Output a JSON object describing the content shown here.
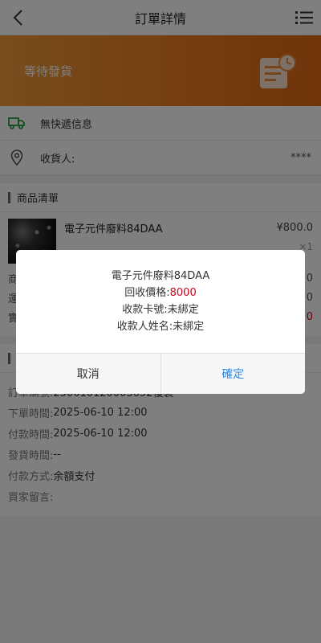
{
  "header": {
    "title": "訂單詳情",
    "back_icon": "back-arrow-icon",
    "menu_icon": "list-menu-icon"
  },
  "banner": {
    "status": "等待發貨",
    "icon": "order-clock-icon",
    "colors": [
      "#f09a3b",
      "#e06916"
    ]
  },
  "shipping": {
    "label": "無快遞信息",
    "icon": "truck-icon"
  },
  "receiver": {
    "label": "收貨人:",
    "value": "****",
    "icon": "location-pin-icon"
  },
  "product_section": {
    "title": "商品清單",
    "product": {
      "name": "電子元件廢料84DAA",
      "price": "¥800.0",
      "qty": "×1"
    },
    "summary": [
      {
        "label": "商",
        "value": "0"
      },
      {
        "label": "運",
        "value": "0"
      },
      {
        "label": "實",
        "value": "0"
      }
    ]
  },
  "order_section": {
    "title": "",
    "rows": [
      {
        "key": "訂單編號:",
        "value": "250610120003652複製"
      },
      {
        "key": "下單時間:",
        "value": "2025-06-10 12:00"
      },
      {
        "key": "付款時間:",
        "value": "2025-06-10 12:00"
      },
      {
        "key": "發貨時間:",
        "value": "--"
      },
      {
        "key": "付款方式:",
        "value": "余額支付"
      },
      {
        "key": "買家留言:",
        "value": ""
      }
    ]
  },
  "dialog": {
    "product_name": "電子元件廢料84DAA",
    "price_label": "回收價格:",
    "price_value": "8000",
    "card_line": "收款卡號:未綁定",
    "name_line": "收款人姓名:未綁定",
    "cancel_label": "取消",
    "confirm_label": "確定"
  }
}
